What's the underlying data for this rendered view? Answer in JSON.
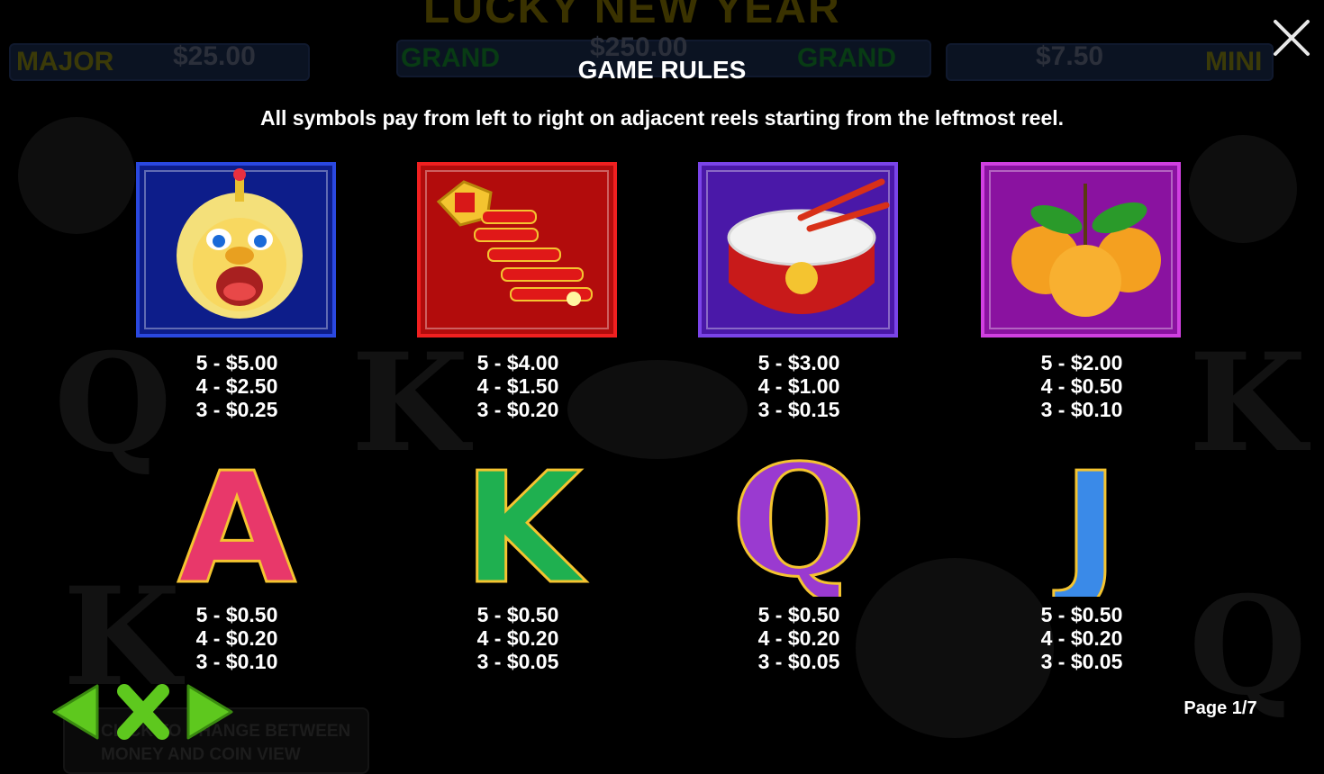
{
  "background": {
    "game_title": "LUCKY NEW YEAR",
    "jackpots": [
      {
        "label": "MAJOR",
        "value": "$25.00",
        "label_color": "#3b3a08"
      },
      {
        "label": "GRAND",
        "value": "$250.00",
        "label_color": "#083b14"
      },
      {
        "label": "GRAND",
        "value": "",
        "label_color": "#083b14"
      },
      {
        "label": "MINI",
        "value": "$7.50",
        "label_color": "#3b3a08"
      }
    ],
    "toggle_text": "CLICK TO CHANGE BETWEEN MONEY AND COIN VIEW"
  },
  "rules": {
    "title": "GAME RULES",
    "description": "All symbols pay from left to right on adjacent reels starting from the leftmost reel.",
    "close_icon": "close-icon"
  },
  "symbols": [
    {
      "name": "lion-dance-head",
      "frame_color": "#1a2fb0",
      "bg_color": "#0d1d8a",
      "pays": [
        "5 - $5.00",
        "4 - $2.50",
        "3 - $0.25"
      ]
    },
    {
      "name": "firecrackers",
      "frame_color": "#d81818",
      "bg_color": "#b20c0c",
      "pays": [
        "5 - $4.00",
        "4 - $1.50",
        "3 - $0.20"
      ]
    },
    {
      "name": "drum",
      "frame_color": "#6a2ad0",
      "bg_color": "#4a18a8",
      "pays": [
        "5 - $3.00",
        "4 - $1.00",
        "3 - $0.15"
      ]
    },
    {
      "name": "oranges",
      "frame_color": "#b82ac8",
      "bg_color": "#8a12a0",
      "pays": [
        "5 - $2.00",
        "4 - $0.50",
        "3 - $0.10"
      ]
    },
    {
      "name": "letter-a",
      "letter": "A",
      "color": "#e8386a",
      "pays": [
        "5 - $0.50",
        "4 - $0.20",
        "3 - $0.10"
      ]
    },
    {
      "name": "letter-k",
      "letter": "K",
      "color": "#1fb050",
      "pays": [
        "5 - $0.50",
        "4 - $0.20",
        "3 - $0.05"
      ]
    },
    {
      "name": "letter-q",
      "letter": "Q",
      "color": "#9a3ad0",
      "pays": [
        "5 - $0.50",
        "4 - $0.20",
        "3 - $0.05"
      ]
    },
    {
      "name": "letter-j",
      "letter": "J",
      "color": "#3a8ae8",
      "pays": [
        "5 - $0.50",
        "4 - $0.20",
        "3 - $0.05"
      ]
    }
  ],
  "navigation": {
    "prev_icon": "arrow-left-icon",
    "close_icon": "close-x-icon",
    "next_icon": "arrow-right-icon",
    "accent_color": "#5ec81e",
    "page_label": "Page 1/7"
  }
}
